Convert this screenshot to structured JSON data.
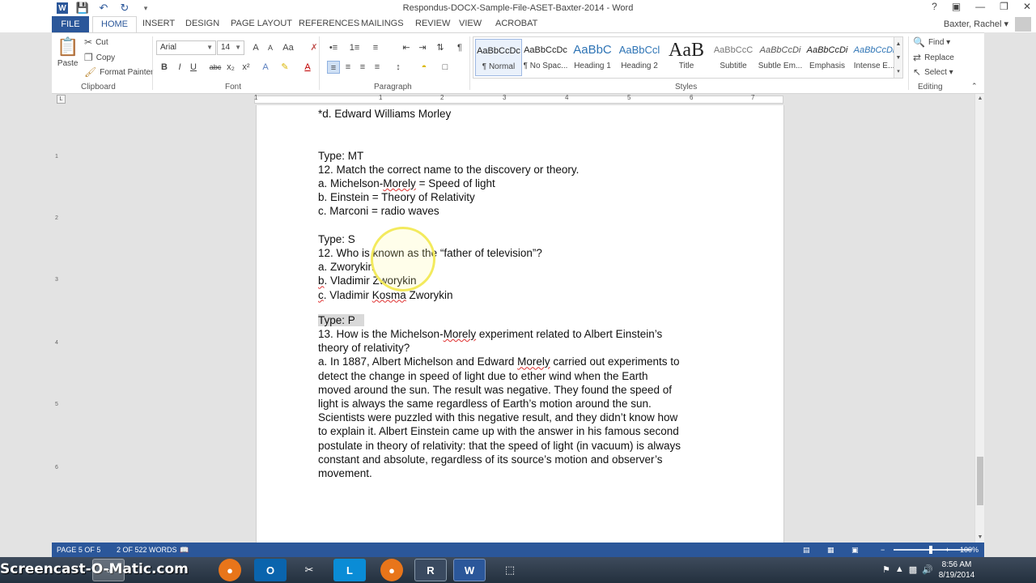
{
  "window": {
    "title": "Respondus-DOCX-Sample-File-ASET-Baxter-2014 - Word",
    "help": "?",
    "controls": [
      "▣",
      "—",
      "❐",
      "✕"
    ]
  },
  "tabs": {
    "file": "FILE",
    "items": [
      "HOME",
      "INSERT",
      "DESIGN",
      "PAGE LAYOUT",
      "REFERENCES",
      "MAILINGS",
      "REVIEW",
      "VIEW",
      "ACROBAT"
    ],
    "active": "HOME",
    "user": "Baxter, Rachel ▾"
  },
  "clipboard": {
    "paste": "Paste",
    "cut": "Cut",
    "copy": "Copy",
    "format_painter": "Format Painter",
    "label": "Clipboard"
  },
  "font": {
    "family": "Arial",
    "size": "14",
    "label": "Font",
    "buttons": [
      "B",
      "I",
      "U",
      "abc",
      "x₂",
      "x²"
    ]
  },
  "paragraph": {
    "label": "Paragraph"
  },
  "styles": {
    "label": "Styles",
    "items": [
      {
        "sample": "AaBbCcDc",
        "name": "¶ Normal",
        "selected": true
      },
      {
        "sample": "AaBbCcDc",
        "name": "¶ No Spac...",
        "selected": false
      },
      {
        "sample": "AaBbC",
        "name": "Heading 1",
        "selected": false
      },
      {
        "sample": "AaBbCcl",
        "name": "Heading 2",
        "selected": false
      },
      {
        "sample": "AaB",
        "name": "Title",
        "selected": false
      },
      {
        "sample": "AaBbCcC",
        "name": "Subtitle",
        "selected": false
      },
      {
        "sample": "AaBbCcDi",
        "name": "Subtle Em...",
        "selected": false
      },
      {
        "sample": "AaBbCcDi",
        "name": "Emphasis",
        "selected": false
      },
      {
        "sample": "AaBbCcDi",
        "name": "Intense E...",
        "selected": false
      }
    ]
  },
  "editing": {
    "label": "Editing",
    "find": "Find ▾",
    "replace": "Replace",
    "select": "Select ▾"
  },
  "ruler": {
    "numbers": [
      "1",
      "1",
      "2",
      "3",
      "4",
      "5",
      "6",
      "7"
    ]
  },
  "vruler": {
    "numbers": [
      "1",
      "2",
      "3",
      "4",
      "5",
      "6"
    ]
  },
  "doc": {
    "l1": "*d. Edward Williams Morley",
    "l2": "Type: MT",
    "l3": "12. Match the correct name to the discovery or theory.",
    "l4a": "a. Michelson-",
    "l4b": "Morely",
    "l4c": " = Speed of light",
    "l5": "b. Einstein = Theory of Relativity",
    "l6": "c. Marconi = radio waves",
    "l7": "Type: S",
    "l8": "12. Who is known as the “father of television”?",
    "l9": "a. Zworykin",
    "l10a": "b",
    "l10b": ". Vladimir Zworykin",
    "l11a": "c",
    "l11b": ". Vladimir ",
    "l11c": "Kosma",
    "l11d": " Zworykin",
    "l12": "Type: P",
    "l13a": "13. How is the Michelson-",
    "l13b": "Morely",
    "l13c": " experiment related to Albert Einstein’s",
    "l14": "theory of relativity?",
    "l15a": "a. In 1887, Albert Michelson and Edward ",
    "l15b": "Morely",
    "l15c": " carried out experiments to",
    "l16": "detect the change in speed of light due to ether wind when the Earth",
    "l17": "moved around the sun. The result was negative. They found the speed of",
    "l18": "light is always the same regardless of Earth’s motion around the sun.",
    "l19": "Scientists were puzzled with this negative result, and they didn’t know how",
    "l20": "to explain it. Albert Einstein came up with the answer in his famous second",
    "l21": "postulate in theory of relativity: that the speed of light (in vacuum) is always",
    "l22": "constant and absolute, regardless of its source’s motion and observer’s",
    "l23": "movement."
  },
  "status": {
    "page": "PAGE 5 OF 5",
    "words": "2 OF 522 WORDS",
    "zoom": "100%",
    "zoom_minus": "−",
    "zoom_plus": "+"
  },
  "taskbar": {
    "brand": "Screencast-O-Matic.com",
    "time": "8:56 AM",
    "date": "8/19/2014"
  }
}
